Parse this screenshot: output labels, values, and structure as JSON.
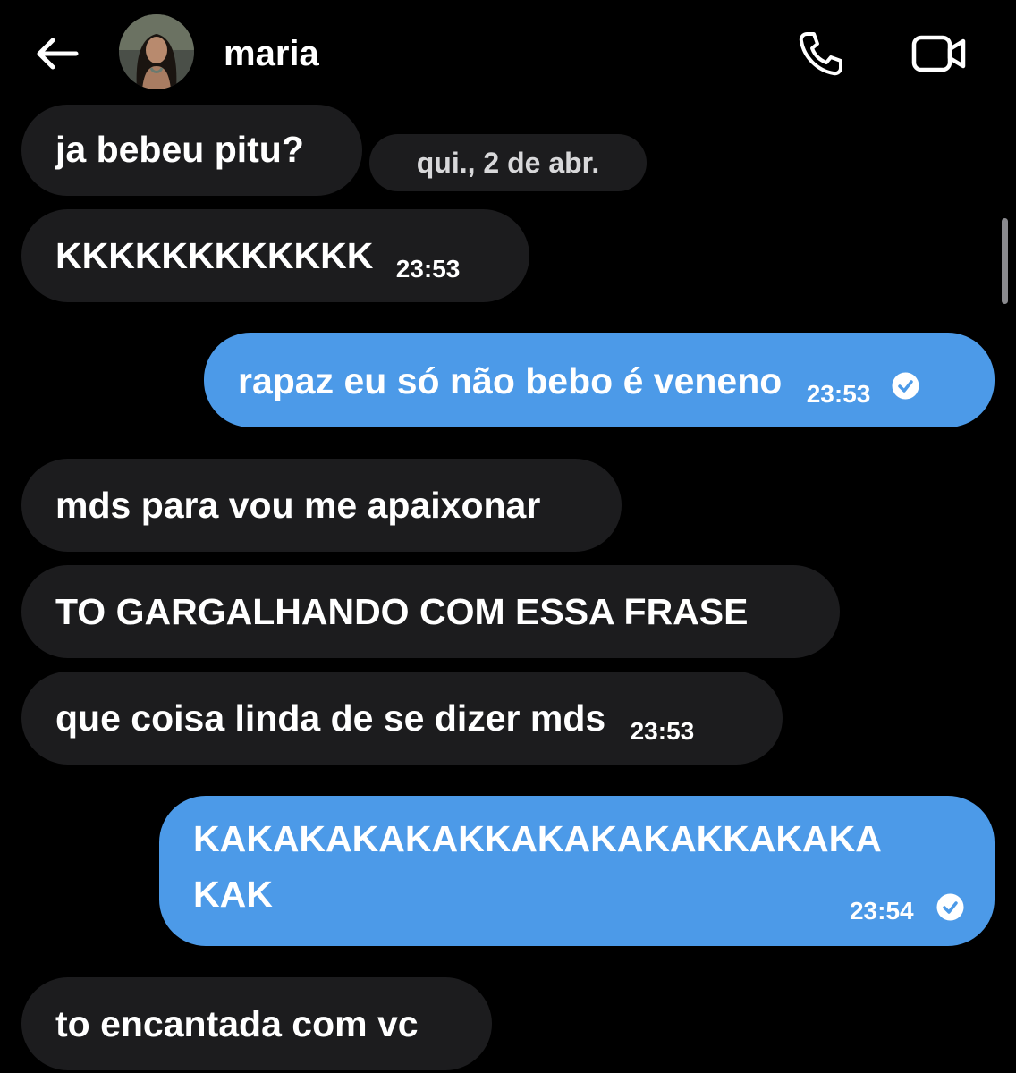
{
  "header": {
    "back_icon": "arrow-left-icon",
    "contact_name": "maria",
    "call_icon": "phone-icon",
    "video_icon": "video-camera-icon"
  },
  "date_separator": "qui., 2 de abr.",
  "messages": [
    {
      "direction": "incoming",
      "text": "ja bebeu pitu?",
      "time": ""
    },
    {
      "direction": "incoming",
      "text": "KKKKKKKKKKKK",
      "time": "23:53"
    },
    {
      "direction": "outgoing",
      "text": "rapaz eu só não bebo é veneno",
      "time": "23:53",
      "status": "read"
    },
    {
      "direction": "incoming",
      "text": "mds para vou me apaixonar",
      "time": ""
    },
    {
      "direction": "incoming",
      "text": "TO GARGALHANDO COM ESSA FRASE",
      "time": ""
    },
    {
      "direction": "incoming",
      "text": "que coisa linda de se dizer mds",
      "time": "23:53"
    },
    {
      "direction": "outgoing",
      "text_line1": "KAKAKAKAKAKKAKAKAKAKKAKAKA",
      "text_line2": "KAK",
      "time": "23:54",
      "status": "read"
    },
    {
      "direction": "incoming",
      "text": "to encantada com vc",
      "time": ""
    }
  ],
  "colors": {
    "background": "#000000",
    "incoming_bubble": "#1c1c1e",
    "outgoing_bubble": "#4c9ae8",
    "text": "#ffffff"
  }
}
